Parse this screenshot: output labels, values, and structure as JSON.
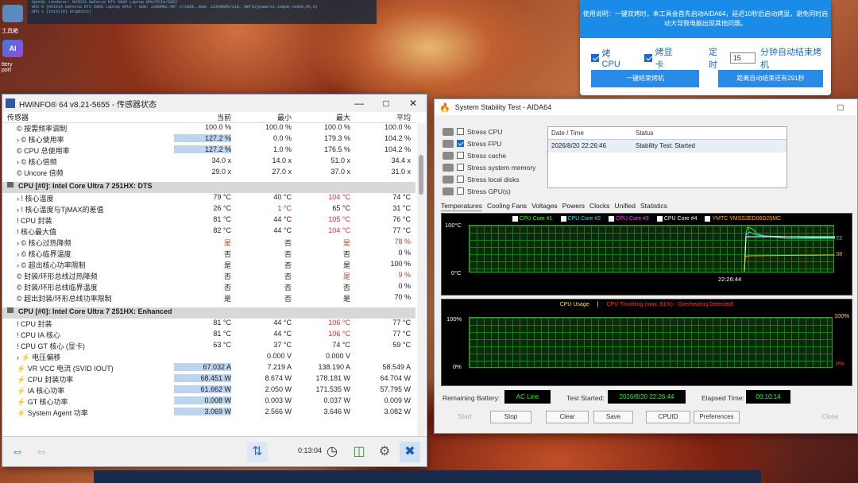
{
  "desktop": {
    "top_lines": [
      "· OpenGL renderer: NVIDIA GeForce RTX 5060 Laptop GPU/PCIe/SSE2",
      "· GPU 0 (NVIDIA GeForce RTX 5060 Laptop GPU) - mem: 2300MHz:40° C/100%, mem: 123FB08h/11%, 6mflp(powerx1,temp0,vedo0,OV,0)",
      "· GPU 1 (Intel(R) Graphics)"
    ],
    "icon_labels": [
      "工具箱",
      "AI",
      "ttery",
      "port"
    ]
  },
  "tool": {
    "info": "使用说明：一键双烤时，本工具会首先启动AIDA64，延迟10秒后启动烤显，避免同时启动大导致电脑出现其他问题。",
    "cpu_label": "烤CPU",
    "gpu_label": "烤显卡",
    "timer_label": "定时",
    "timer_value": "15",
    "timer_suffix": "分钟自动结束烤机",
    "btn_stop": "一键结束烤机",
    "btn_countdown": "距离自动结束还有291秒"
  },
  "hwinfo": {
    "title": "HWiNFO® 64 v8.21-5655 - 传感器状态",
    "headers": {
      "sensor": "传感器",
      "cur": "当前",
      "min": "最小",
      "max": "最大",
      "avg": "平均"
    },
    "rows_a": [
      {
        "label": "© 按需频率调制",
        "cur": "100.0 %",
        "min": "100.0 %",
        "max": "100.0 %",
        "avg": "100.0 %",
        "sub": false
      },
      {
        "label": "› © 核心使用率",
        "cur": "127.2 %",
        "min": "0.0 %",
        "max": "179.3 %",
        "avg": "104.2 %",
        "sub": false,
        "hl": true
      },
      {
        "label": "© CPU 总使用率",
        "cur": "127.2 %",
        "min": "1.0 %",
        "max": "176.5 %",
        "avg": "104.2 %",
        "sub": false,
        "hl": true
      },
      {
        "label": "› © 核心倍频",
        "cur": "34.0 x",
        "min": "14.0 x",
        "max": "51.0 x",
        "avg": "34.4 x",
        "sub": false
      },
      {
        "label": "© Uncore 倍频",
        "cur": "29.0 x",
        "min": "27.0 x",
        "max": "37.0 x",
        "avg": "31.0 x",
        "sub": false
      }
    ],
    "group_b": "CPU [#0]: Intel Core Ultra 7 251HX: DTS",
    "rows_b": [
      {
        "label": "› ! 核心温度",
        "cur": "79 °C",
        "min": "40 °C",
        "max": "104 °C",
        "avg": "74 °C",
        "maxred": true
      },
      {
        "label": "› ! 核心温度与TjMAX的差值",
        "cur": "26 °C",
        "min": "1 °C",
        "max": "65 °C",
        "avg": "31 °C",
        "minred": true
      },
      {
        "label": "! CPU 封装",
        "cur": "81 °C",
        "min": "44 °C",
        "max": "105 °C",
        "avg": "76 °C",
        "maxred": true
      },
      {
        "label": "! 核心最大值",
        "cur": "82 °C",
        "min": "44 °C",
        "max": "104 °C",
        "avg": "77 °C",
        "maxred": true
      },
      {
        "label": "› © 核心过热降频",
        "cur": "是",
        "min": "否",
        "max": "是",
        "avg": "78 %",
        "curred": true,
        "maxred": true,
        "avgred": true
      },
      {
        "label": "› © 核心临界温度",
        "cur": "否",
        "min": "否",
        "max": "否",
        "avg": "0 %"
      },
      {
        "label": "› © 超出核心功率限制",
        "cur": "是",
        "min": "否",
        "max": "是",
        "avg": "100 %"
      },
      {
        "label": "© 封装/环形总线过热降频",
        "cur": "否",
        "min": "否",
        "max": "是",
        "avg": "9 %",
        "maxred": true,
        "avgred": true
      },
      {
        "label": "© 封装/环形总线临界温度",
        "cur": "否",
        "min": "否",
        "max": "否",
        "avg": "0 %"
      },
      {
        "label": "© 超出封装/环形总线功率限制",
        "cur": "是",
        "min": "否",
        "max": "是",
        "avg": "70 %"
      }
    ],
    "group_c": "CPU [#0]: Intel Core Ultra 7 251HX: Enhanced",
    "rows_c": [
      {
        "label": "! CPU 封装",
        "cur": "81 °C",
        "min": "44 °C",
        "max": "106 °C",
        "avg": "77 °C",
        "maxred": true
      },
      {
        "label": "! CPU IA 核心",
        "cur": "81 °C",
        "min": "44 °C",
        "max": "106 °C",
        "avg": "77 °C",
        "maxred": true
      },
      {
        "label": "! CPU GT 核心 (显卡)",
        "cur": "63 °C",
        "min": "37 °C",
        "max": "74 °C",
        "avg": "59 °C"
      },
      {
        "label": "› ⚡ 电压偏移",
        "cur": "",
        "min": "0.000 V",
        "max": "0.000 V",
        "avg": ""
      },
      {
        "label": "⚡ VR VCC 电流 (SVID IOUT)",
        "cur": "67.032 A",
        "min": "7.219 A",
        "max": "138.190 A",
        "avg": "58.549 A",
        "hl": true
      },
      {
        "label": "⚡ CPU 封装功率",
        "cur": "68.451 W",
        "min": "8.674 W",
        "max": "178.181 W",
        "avg": "64.704 W",
        "hl": true
      },
      {
        "label": "⚡ IA 核心功率",
        "cur": "61.662 W",
        "min": "2.050 W",
        "max": "171.535 W",
        "avg": "57.795 W",
        "hl": true
      },
      {
        "label": "⚡ GT 核心功率",
        "cur": "0.008 W",
        "min": "0.003 W",
        "max": "0.037 W",
        "avg": "0.009 W",
        "hl": true
      },
      {
        "label": "⚡ System Agent 功率",
        "cur": "3.069 W",
        "min": "2.566 W",
        "max": "3.646 W",
        "avg": "3.082 W",
        "hl": true
      }
    ],
    "elapsed": "0:13:04"
  },
  "aida": {
    "title": "System Stability Test - AIDA64",
    "stress": [
      {
        "label": "Stress CPU",
        "checked": false
      },
      {
        "label": "Stress FPU",
        "checked": true
      },
      {
        "label": "Stress cache",
        "checked": false
      },
      {
        "label": "Stress system memory",
        "checked": false
      },
      {
        "label": "Stress local disks",
        "checked": false
      },
      {
        "label": "Stress GPU(s)",
        "checked": false
      }
    ],
    "table": {
      "h_date": "Date / Time",
      "h_status": "Status",
      "date": "2026/8/20 22:26:46",
      "status": "Stability Test: Started"
    },
    "tabs": [
      "Temperatures",
      "Cooling Fans",
      "Voltages",
      "Powers",
      "Clocks",
      "Unified",
      "Statistics"
    ],
    "temp_legend": [
      "CPU Core #1",
      "CPU Core #2",
      "CPU Core #3",
      "CPU Core #4",
      "YMTC YMSS2ED06D25MC"
    ],
    "temp_legend_colors": [
      "#30ff30",
      "#30e0ff",
      "#ff40ff",
      "#ffffff",
      "#ffb030"
    ],
    "temp_top": "100°C",
    "temp_bottom": "0°C",
    "temp_time": "22:26:44",
    "temp_val_1": "72",
    "temp_val_2": "38",
    "usage_title_a": "CPU Usage",
    "usage_sep": "|",
    "usage_title_b": "CPU Throttling (max: 81%) - Overheating Detected!",
    "usage_top_left": "100%",
    "usage_bottom_left": "0%",
    "usage_top_right": "100%",
    "usage_bottom_right": "0%",
    "battery_label": "Remaining Battery:",
    "battery_value": "AC Line",
    "started_label": "Test Started:",
    "started_value": "2026/8/20 22:26:44",
    "elapsed_label": "Elapsed Time:",
    "elapsed_value": "00:10:14",
    "buttons": {
      "start": "Start",
      "stop": "Stop",
      "clear": "Clear",
      "save": "Save",
      "cpuid": "CPUID",
      "prefs": "Preferences",
      "close": "Close"
    }
  }
}
